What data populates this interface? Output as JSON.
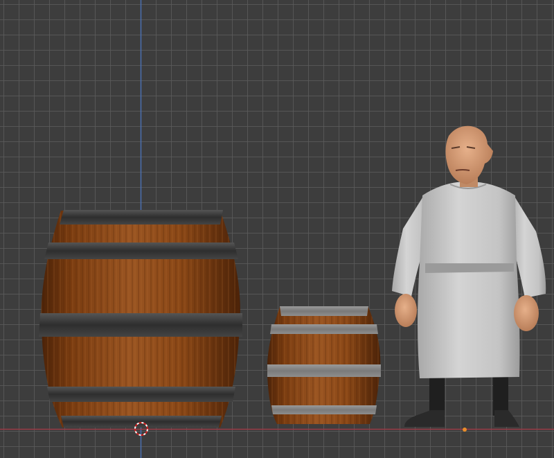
{
  "app": "3D viewport",
  "viewport": {
    "background": "#3d3d3d",
    "grid_color": "#5a5a5a",
    "x_axis_color": "#9b3a46",
    "z_axis_color": "#4a6fb0",
    "origin_color": "#e88d2a"
  },
  "objects": [
    {
      "name": "large-barrel",
      "band_color": "#3a3a3a",
      "wood_color": "#8a4a1a"
    },
    {
      "name": "small-barrel",
      "band_color": "#8a8a8a",
      "wood_color": "#8a4a1a"
    },
    {
      "name": "old-man-character",
      "robe_color": "#cfcfcf",
      "skin_color": "#d8a07a"
    }
  ]
}
